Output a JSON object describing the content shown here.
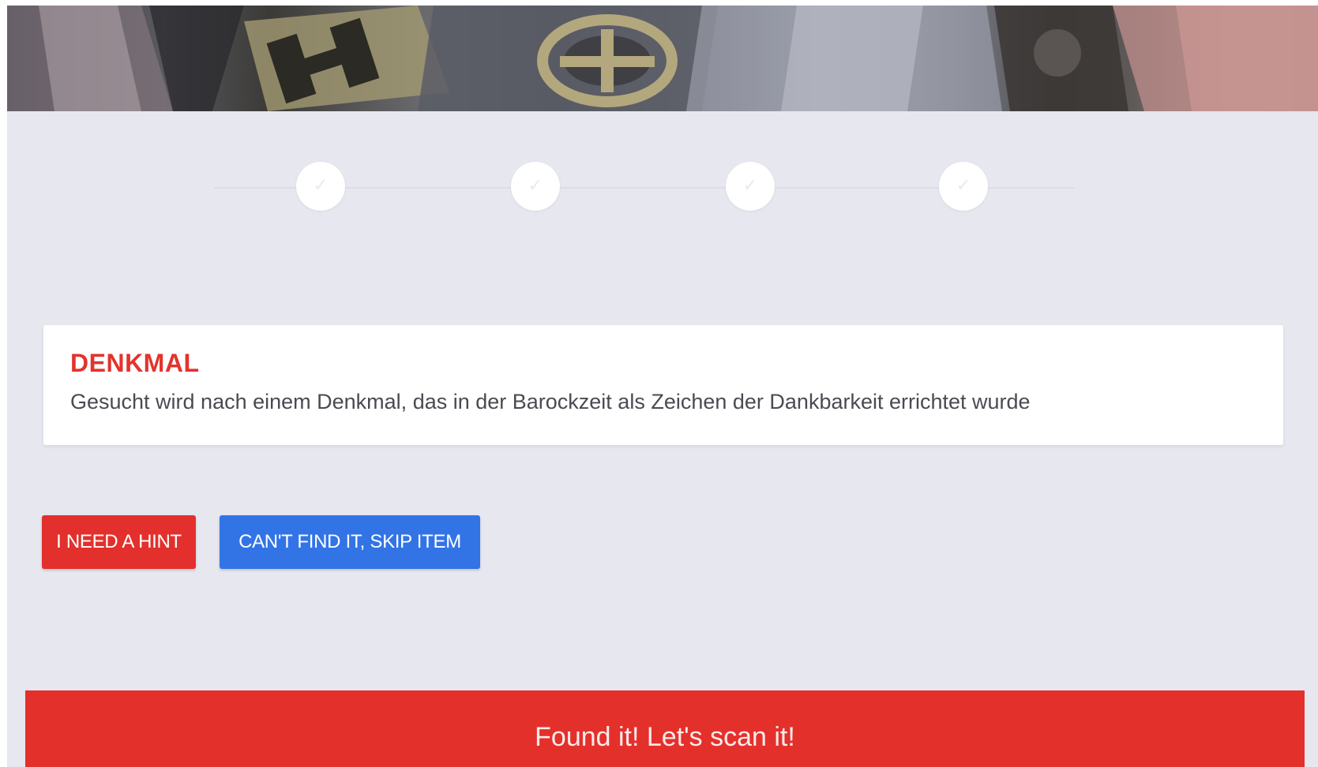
{
  "hero": {
    "image_icon": "monument-detail-photo"
  },
  "stepper": {
    "steps": [
      {
        "status": "completed",
        "icon": "check-icon",
        "glyph": "✓"
      },
      {
        "status": "completed",
        "icon": "check-icon",
        "glyph": "✓"
      },
      {
        "status": "completed",
        "icon": "check-icon",
        "glyph": "✓"
      },
      {
        "status": "completed",
        "icon": "check-icon",
        "glyph": "✓"
      }
    ]
  },
  "task": {
    "title": "DENKMAL",
    "description": "Gesucht wird nach einem Denkmal, das in der Barockzeit als Zeichen der Dankbarkeit errichtet wurde"
  },
  "actions": {
    "hint_label": "I NEED A HINT",
    "skip_label": "CAN'T FIND IT, SKIP ITEM",
    "found_label": "Found it! Let's scan it!"
  },
  "colors": {
    "background": "#e6e7ef",
    "accent_red": "#e3302c",
    "accent_blue": "#3274e6",
    "card": "#ffffff"
  }
}
